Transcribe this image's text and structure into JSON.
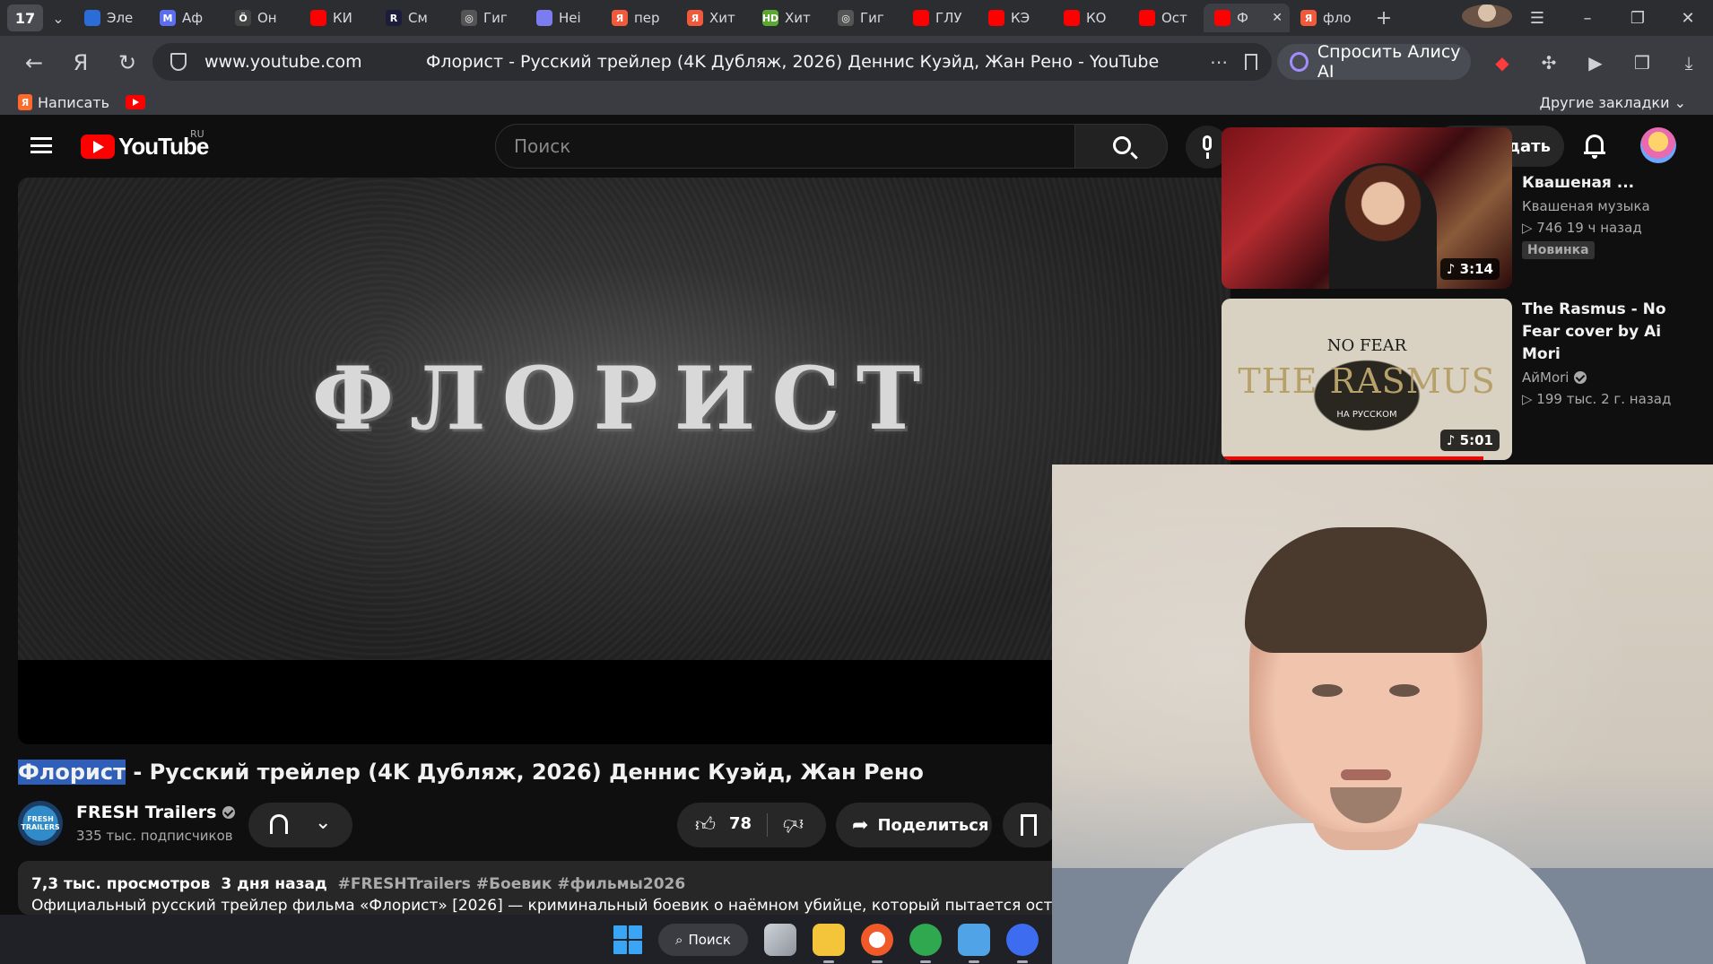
{
  "browser": {
    "tab_count": "17",
    "tabs": [
      {
        "label": "Эле",
        "color": "#2c6cd6",
        "glyph": ""
      },
      {
        "label": "Аф",
        "color": "#5b6ef0",
        "glyph": "M"
      },
      {
        "label": "Он",
        "color": "#444",
        "glyph": "Ö"
      },
      {
        "label": "КИ",
        "color": "#ff0000",
        "glyph": ""
      },
      {
        "label": "См",
        "color": "#1c1c3a",
        "glyph": "R"
      },
      {
        "label": "Гиг",
        "color": "#555",
        "glyph": "◎"
      },
      {
        "label": "Нei",
        "color": "#7a7cf0",
        "glyph": ""
      },
      {
        "label": "пер",
        "color": "#f05a3c",
        "glyph": "Я"
      },
      {
        "label": "Хит",
        "color": "#f05a3c",
        "glyph": "Я"
      },
      {
        "label": "Хит",
        "color": "#5aa832",
        "glyph": "HD"
      },
      {
        "label": "Гиг",
        "color": "#555",
        "glyph": "◎"
      },
      {
        "label": "ГЛУ",
        "color": "#ff0000",
        "glyph": ""
      },
      {
        "label": "КЭ",
        "color": "#ff0000",
        "glyph": ""
      },
      {
        "label": "КО",
        "color": "#ff0000",
        "glyph": ""
      },
      {
        "label": "Ост",
        "color": "#ff0000",
        "glyph": ""
      },
      {
        "label": "Ф",
        "color": "#ff0000",
        "glyph": "",
        "active": true
      },
      {
        "label": "фло",
        "color": "#f05a3c",
        "glyph": "Я"
      }
    ],
    "address": {
      "domain": "www.youtube.com",
      "page_title": "Флорист - Русский трейлер (4K Дубляж, 2026) Деннис Куэйд, Жан Рено - YouTube"
    },
    "alice_button": "Спросить Алису AI",
    "bookmarks": {
      "write": "Написать",
      "other": "Другие закладки"
    }
  },
  "youtube": {
    "region": "RU",
    "logo_text": "YouTube",
    "search_placeholder": "Поиск",
    "create_label": "Создать",
    "player": {
      "frame_text": "ФЛОРИСТ"
    },
    "video": {
      "title_highlight": "Флорист",
      "title_rest": " - Русский трейлер (4K Дубляж, 2026) Деннис Куэйд, Жан Рено",
      "channel": {
        "name": "FRESH Trailers",
        "subscribers": "335 тыс. подписчиков",
        "avatar_text": "FRESH TRAILERS"
      },
      "likes": "78",
      "share_label": "Поделиться",
      "description": {
        "views": "7,3 тыс. просмотров",
        "date": "3 дня назад",
        "tags": "#FRESHTrailers #Боевик #фильмы2026",
        "text": "Официальный русский трейлер фильма «Флорист» [2026] — криминальный боевик о наёмном убийце, который пытается оставить прошл"
      }
    },
    "recommendations": [
      {
        "title": "Квашеная ...",
        "channel": "Квашеная музыка",
        "stats": "▷ 746   19 ч назад",
        "badge": "Новинка",
        "duration": "♪ 3:14",
        "progress": 0
      },
      {
        "title": "The Rasmus - No Fear cover by Ai Mori",
        "channel": "АйMori",
        "stats": "▷ 199 тыс.   2 г. назад",
        "badge": "",
        "duration": "♪ 5:01",
        "progress": 0.9,
        "thumb_text": {
          "top": "NO FEAR",
          "band": "THE RASMUS",
          "sub": "НА РУССКОМ"
        }
      }
    ]
  },
  "taskbar": {
    "search_label": "Поиск"
  }
}
